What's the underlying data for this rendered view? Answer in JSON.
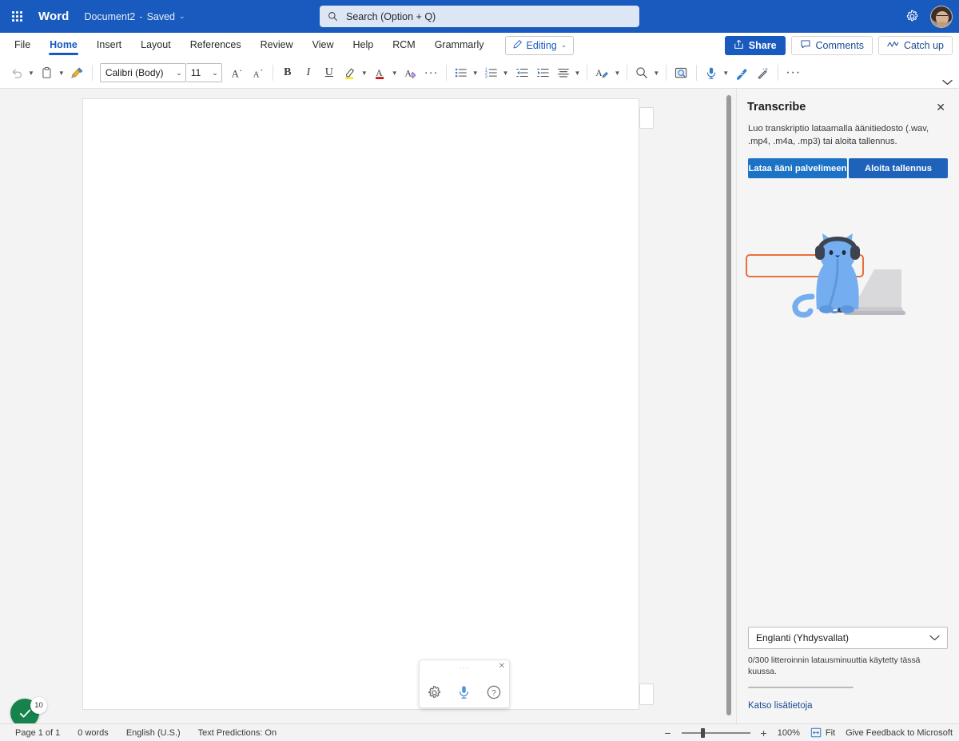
{
  "titlebar": {
    "waffle_label": "app-launcher",
    "app_name": "Word",
    "doc_name": "Document2",
    "separator": "-",
    "save_state": "Saved",
    "chevron": "⌄",
    "settings_icon": "gear-icon",
    "avatar_label": "user-avatar"
  },
  "search": {
    "placeholder": "Search (Option + Q)",
    "value": "",
    "icon": "search-icon"
  },
  "ribbon": {
    "tabs": [
      {
        "label": "File",
        "active": false
      },
      {
        "label": "Home",
        "active": true
      },
      {
        "label": "Insert",
        "active": false
      },
      {
        "label": "Layout",
        "active": false
      },
      {
        "label": "References",
        "active": false
      },
      {
        "label": "Review",
        "active": false
      },
      {
        "label": "View",
        "active": false
      },
      {
        "label": "Help",
        "active": false
      },
      {
        "label": "RCM",
        "active": false
      },
      {
        "label": "Grammarly",
        "active": false
      }
    ],
    "editing_label": "Editing",
    "editing_icon": "pencil-icon",
    "share_label": "Share",
    "comments_label": "Comments",
    "catchup_label": "Catch up",
    "collapse_icon": "chevron-down-icon"
  },
  "toolbar": {
    "undo_icon": "undo-icon",
    "paste_icon": "clipboard-icon",
    "format_painter_icon": "format-painter-icon",
    "font_name": "Calibri (Body)",
    "font_size": "11",
    "grow_font_icon": "grow-font-icon",
    "shrink_font_icon": "shrink-font-icon",
    "bold_label": "B",
    "italic_label": "I",
    "underline_label": "U",
    "highlight_icon": "text-highlight-icon",
    "font_color_icon": "font-color-icon",
    "clear_format_icon": "clear-formatting-icon",
    "more_font_icon": "more-options-icon",
    "bullets_icon": "bullet-list-icon",
    "numbering_icon": "numbered-list-icon",
    "decrease_indent_icon": "decrease-indent-icon",
    "increase_indent_icon": "increase-indent-icon",
    "align_icon": "align-left-icon",
    "styles_icon": "styles-icon",
    "find_icon": "find-icon",
    "editor_icon": "editor-icon",
    "dictate_icon": "microphone-icon",
    "designer_icon": "designer-icon",
    "copilot_icon": "copilot-wand-icon",
    "more_icon": "more-options-icon"
  },
  "document": {
    "page_label": "document-page",
    "margin_button_label": "margin-note-button"
  },
  "floating_toolbar": {
    "grip": "···",
    "close": "✕",
    "settings_icon": "gear-icon",
    "mic_icon": "microphone-icon",
    "help_icon": "help-icon"
  },
  "grammar_badge": {
    "check_icon": "checkmark-icon",
    "count": "10"
  },
  "pane": {
    "title": "Transcribe",
    "close_icon": "close-icon",
    "description": "Luo transkriptio lataamalla äänitiedosto (.wav, .mp4, .m4a, .mp3) tai aloita tallennus.",
    "upload_button": "Lataa ääni palvelimeen",
    "record_button": "Aloita tallennus",
    "illustration": "cat-with-headphones-at-laptop-illustration",
    "language_value": "Englanti (Yhdysvallat)",
    "language_chevron": "⌄",
    "quota_text": "0/300 litteroinnin latausminuuttia käytetty tässä kuussa.",
    "more_info_link": "Katso lisätietoja",
    "focus_color": "#e8703a"
  },
  "statusbar": {
    "page_info": "Page 1 of 1",
    "word_count": "0 words",
    "language": "English (U.S.)",
    "text_predictions": "Text Predictions: On",
    "zoom_out_icon": "minus-icon",
    "zoom_in_icon": "plus-icon",
    "zoom_level": "100%",
    "fit_label": "Fit",
    "fit_icon": "fit-page-icon",
    "feedback": "Give Feedback to Microsoft"
  },
  "colors": {
    "brand_blue": "#185abd",
    "accent_button": "#1c72c4",
    "focus_orange": "#e8703a",
    "pane_bg": "#f5f5f5",
    "canvas_bg": "#f3f3f3",
    "grammar_green": "#15834b"
  }
}
